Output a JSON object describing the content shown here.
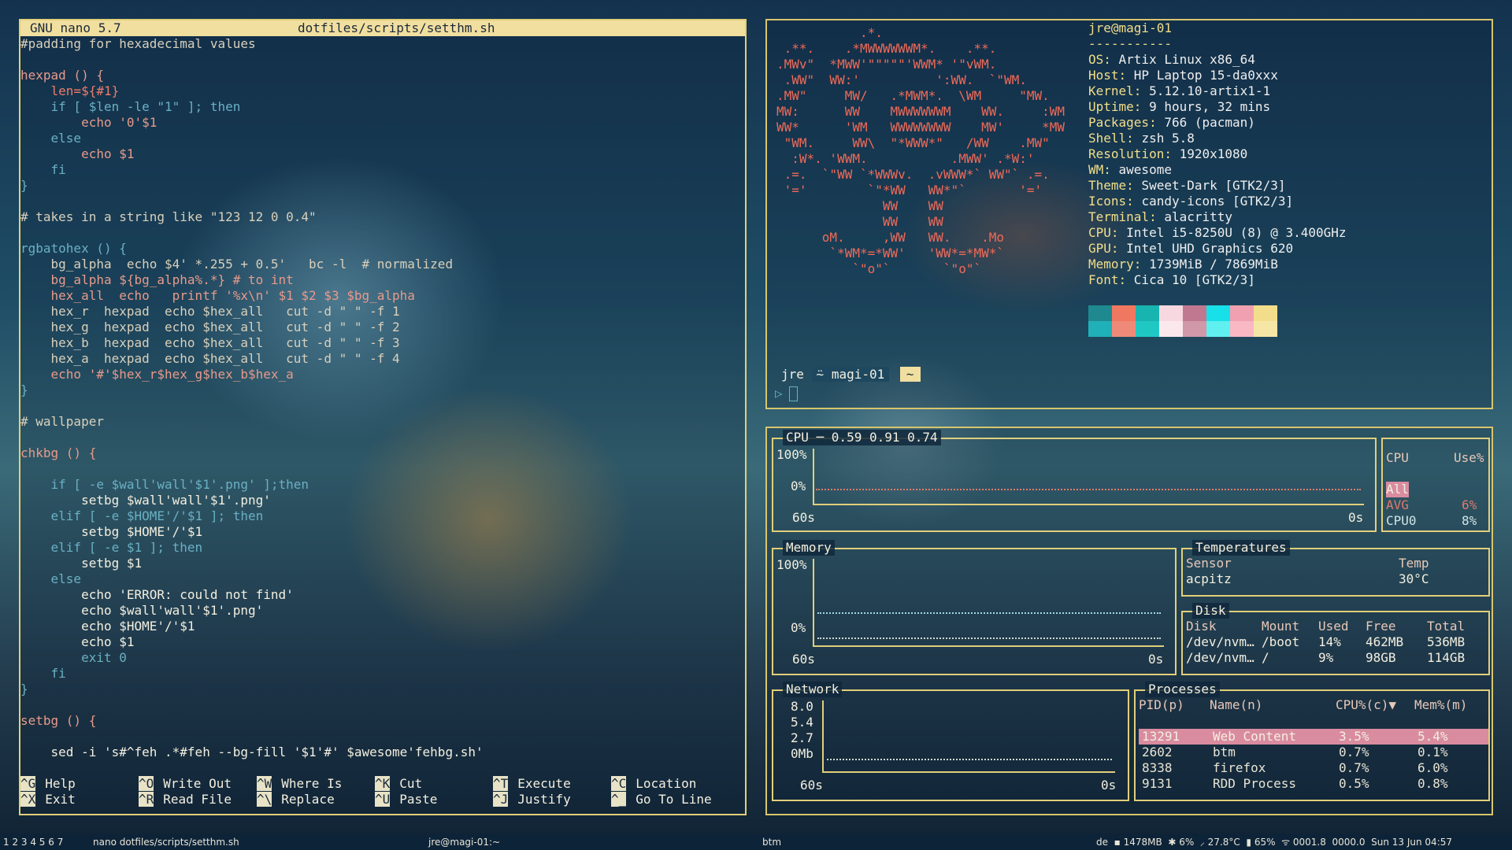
{
  "colors": {
    "accent": "#e2cf7a",
    "nano_bar": "#f1dfa0",
    "selected_row": "#d98ca0"
  },
  "nano": {
    "version": "GNU nano 5.7",
    "file": "dotfiles/scripts/setthm.sh",
    "help": [
      {
        "key": "^G",
        "label": "Help"
      },
      {
        "key": "^O",
        "label": "Write Out"
      },
      {
        "key": "^W",
        "label": "Where Is"
      },
      {
        "key": "^K",
        "label": "Cut"
      },
      {
        "key": "^T",
        "label": "Execute"
      },
      {
        "key": "^C",
        "label": "Location"
      },
      {
        "key": "^X",
        "label": "Exit"
      },
      {
        "key": "^R",
        "label": "Read File"
      },
      {
        "key": "^\\",
        "label": "Replace"
      },
      {
        "key": "^U",
        "label": "Paste"
      },
      {
        "key": "^J",
        "label": "Justify"
      },
      {
        "key": "^_",
        "label": "Go To Line"
      }
    ]
  },
  "code": [
    {
      "t": "#padding for hexadecimal values",
      "c": "cm"
    },
    {
      "t": "",
      "c": "w"
    },
    {
      "t": "hexpad () {",
      "c": "fn"
    },
    {
      "t": "    len=${#1}",
      "c": "var"
    },
    {
      "t": "    if [ $len -le \"1\" ]; then",
      "c": "kw"
    },
    {
      "t": "        echo '0'$1",
      "c": "fn"
    },
    {
      "t": "    else",
      "c": "kw"
    },
    {
      "t": "        echo $1",
      "c": "fn"
    },
    {
      "t": "    fi",
      "c": "kw"
    },
    {
      "t": "}",
      "c": "kw"
    },
    {
      "t": "",
      "c": "w"
    },
    {
      "t": "# takes in a string like \"123 12 0 0.4\"",
      "c": "cm"
    },
    {
      "t": "",
      "c": "w"
    },
    {
      "t": "rgbatohex () {",
      "c": "kw"
    },
    {
      "t": "    bg_alpha  echo $4' *.255 + 0.5'   bc -l  # normalized",
      "c": "cm"
    },
    {
      "t": "    bg_alpha ${bg_alpha%.*} # to int",
      "c": "fn"
    },
    {
      "t": "    hex_all  echo   printf '%x\\n' $1 $2 $3 $bg_alpha",
      "c": "fn"
    },
    {
      "t": "    hex_r  hexpad  echo $hex_all   cut -d \" \" -f 1",
      "c": "cm"
    },
    {
      "t": "    hex_g  hexpad  echo $hex_all   cut -d \" \" -f 2",
      "c": "cm"
    },
    {
      "t": "    hex_b  hexpad  echo $hex_all   cut -d \" \" -f 3",
      "c": "cm"
    },
    {
      "t": "    hex_a  hexpad  echo $hex_all   cut -d \" \" -f 4",
      "c": "cm"
    },
    {
      "t": "    echo '#'$hex_r$hex_g$hex_b$hex_a",
      "c": "fn"
    },
    {
      "t": "}",
      "c": "kw"
    },
    {
      "t": "",
      "c": "w"
    },
    {
      "t": "# wallpaper",
      "c": "cm"
    },
    {
      "t": "",
      "c": "w"
    },
    {
      "t": "chkbg () {",
      "c": "fn"
    },
    {
      "t": "",
      "c": "w"
    },
    {
      "t": "    if [ -e $wall'wall'$1'.png' ];then",
      "c": "kw"
    },
    {
      "t": "        setbg $wall'wall'$1'.png'",
      "c": "w"
    },
    {
      "t": "    elif [ -e $HOME'/'$1 ]; then",
      "c": "kw"
    },
    {
      "t": "        setbg $HOME'/'$1",
      "c": "w"
    },
    {
      "t": "    elif [ -e $1 ]; then",
      "c": "kw"
    },
    {
      "t": "        setbg $1",
      "c": "w"
    },
    {
      "t": "    else",
      "c": "kw"
    },
    {
      "t": "        echo 'ERROR: could not find'",
      "c": "w"
    },
    {
      "t": "        echo $wall'wall'$1'.png'",
      "c": "w"
    },
    {
      "t": "        echo $HOME'/'$1",
      "c": "w"
    },
    {
      "t": "        echo $1",
      "c": "w"
    },
    {
      "t": "        exit 0",
      "c": "kw"
    },
    {
      "t": "    fi",
      "c": "kw"
    },
    {
      "t": "}",
      "c": "kw"
    },
    {
      "t": "",
      "c": "w"
    },
    {
      "t": "setbg () {",
      "c": "fn"
    },
    {
      "t": "",
      "c": "w"
    },
    {
      "t": "    sed -i 's#^feh .*#feh --bg-fill '$1'#' $awesome'fehbg.sh'",
      "c": "w"
    }
  ],
  "neofetch": {
    "ascii": [
      "           .*.          ",
      " .**.    .*MWWWWWWM*.    .**. ",
      ".MWv\"  *MWW'\"\"\"\"\"'WWM* '\"vWM.",
      " .WW\"  WW:'          ':WW.  `\"WM.",
      ".MW\"     MW/   .*MWM*.  \\WM     \"MW.",
      "MW:      WW    MWWWWWWM    WW.     :WM",
      "WW*      'WM   WWWWWWWW    MW'     *MW",
      " \"WM.     WW\\  \"*WWW*\"   /WW    .MW\"",
      "  :W*. 'WWM.           .MWW' .*W:'",
      " .=.  `\"WW `*WWWv.  .vWWW*` WW\"` .=.",
      " '='        `\"*WW   WW*\"`       '='",
      "              WW    WW",
      "              WW    WW",
      "      oM.     ,WW   WW.    .Mo",
      "       `*WM*=*WW'   'WW*=*MW*`",
      "          `\"o\"`       `\"o\"`"
    ],
    "user": "jre@magi-01",
    "sep": "-----------",
    "info": [
      {
        "k": "OS",
        "v": "Artix Linux x86_64"
      },
      {
        "k": "Host",
        "v": "HP Laptop 15-da0xxx"
      },
      {
        "k": "Kernel",
        "v": "5.12.10-artix1-1"
      },
      {
        "k": "Uptime",
        "v": "9 hours, 32 mins"
      },
      {
        "k": "Packages",
        "v": "766 (pacman)"
      },
      {
        "k": "Shell",
        "v": "zsh 5.8"
      },
      {
        "k": "Resolution",
        "v": "1920x1080"
      },
      {
        "k": "WM",
        "v": "awesome"
      },
      {
        "k": "Theme",
        "v": "Sweet-Dark [GTK2/3]"
      },
      {
        "k": "Icons",
        "v": "candy-icons [GTK2/3]"
      },
      {
        "k": "Terminal",
        "v": "alacritty"
      },
      {
        "k": "CPU",
        "v": "Intel i5-8250U (8) @ 3.400GHz"
      },
      {
        "k": "GPU",
        "v": "Intel UHD Graphics 620"
      },
      {
        "k": "Memory",
        "v": "1739MiB / 7869MiB"
      },
      {
        "k": "Font",
        "v": "Cica 10 [GTK2/3]"
      }
    ],
    "palette_top": [
      "#1e8a90",
      "#f07860",
      "#18b4b0",
      "#f8d8e0",
      "#c07890",
      "#18e0e8",
      "#f0a0b0",
      "#f2de8a"
    ],
    "palette_bottom": [
      "#20b0b8",
      "#f08a78",
      "#20c8c4",
      "#fae8ec",
      "#d098a8",
      "#60f0f0",
      "#f8b8c4",
      "#f6e6a6"
    ],
    "prompt_user": "jre",
    "prompt_host": "magi-01",
    "prompt_dir": "~",
    "prompt_arrow": "▷"
  },
  "btm": {
    "cpu_title": "CPU ─ 0.59 0.91 0.74",
    "cpu_y": [
      "100%",
      "0%"
    ],
    "cpu_x": [
      "60s",
      "0s"
    ],
    "cpu_table": {
      "h1": "CPU",
      "h2": "Use%",
      "rows": [
        {
          "n": "All",
          "v": ""
        },
        {
          "n": "AVG",
          "v": "6%"
        },
        {
          "n": "CPU0",
          "v": "8%"
        }
      ]
    },
    "mem_title": "Memory",
    "mem_y": [
      "100%",
      "0%"
    ],
    "mem_x": [
      "60s",
      "0s"
    ],
    "temp_title": "Temperatures",
    "temp_h": [
      "Sensor",
      "Temp"
    ],
    "temp_rows": [
      [
        "acpitz",
        "30°C"
      ]
    ],
    "disk_title": "Disk",
    "disk_h": [
      "Disk",
      "Mount",
      "Used",
      "Free",
      "Total"
    ],
    "disk_rows": [
      [
        "/dev/nvm…",
        "/boot",
        "14%",
        "462MB",
        "536MB"
      ],
      [
        "/dev/nvm…",
        "/",
        "9%",
        "98GB",
        "114GB"
      ]
    ],
    "net_title": "Network",
    "net_y": [
      "8.0",
      "5.4",
      "2.7",
      "0Mb"
    ],
    "net_x": [
      "60s",
      "0s"
    ],
    "proc_title": "Processes",
    "proc_h": [
      "PID(p)",
      "Name(n)",
      "CPU%(c)▼",
      "Mem%(m)"
    ],
    "proc_rows": [
      [
        "13291",
        "Web Content",
        "3.5%",
        "5.4%"
      ],
      [
        "2602",
        "btm",
        "0.7%",
        "0.1%"
      ],
      [
        "8338",
        "firefox",
        "0.7%",
        "6.0%"
      ],
      [
        "9131",
        "RDD Process",
        "0.5%",
        "0.8%"
      ]
    ]
  },
  "statusbar": {
    "tags": "1 2 3 4 5 6 7",
    "task1": "nano dotfiles/scripts/setthm.sh",
    "task2": "jre@magi-01:~",
    "task3": "btm",
    "right": "de  ▪ 1478MB  ✱ 6%  ⸝ 27.8°C  ▮ 65%  ᯤ 0001.8  0000.0  Sun 13 Jun 04:57"
  }
}
